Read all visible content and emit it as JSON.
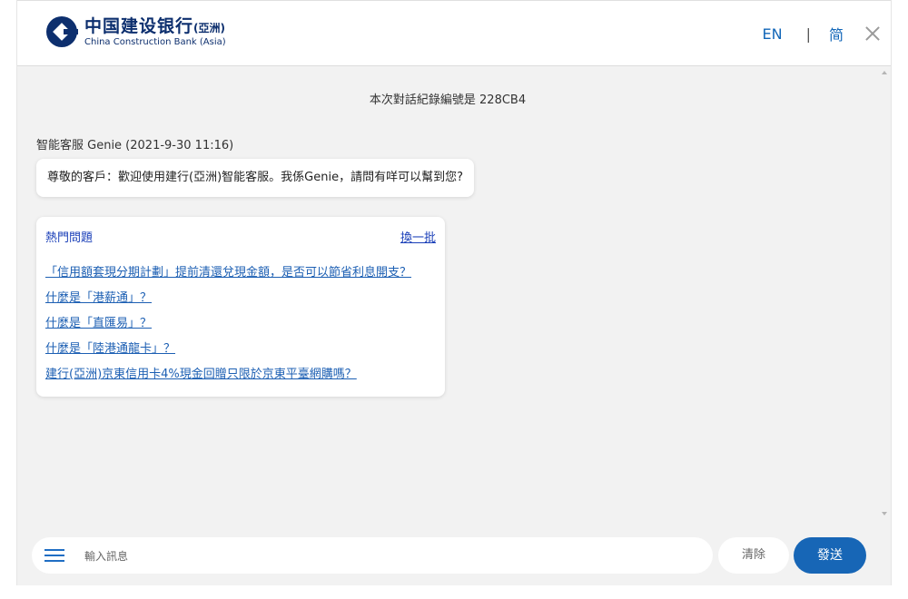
{
  "header": {
    "logo_cn": "中国建设银行",
    "logo_cn_suffix": "(亞洲)",
    "logo_en": "China Construction Bank (Asia)",
    "lang_en": "EN",
    "separator": "|",
    "lang_simplified": "简"
  },
  "chat": {
    "record_notice": "本次對話紀錄編號是 228CB4",
    "sender_line": "智能客服 Genie (2021-9-30 11:16)",
    "greeting": "尊敬的客戶：歡迎使用建行(亞洲)智能客服。我係Genie，請問有咩可以幫到您?",
    "hot_questions": {
      "title": "熱門問題",
      "refresh_label": "換一批",
      "items": [
        "「信用額套現分期計劃」提前清還兌現金額，是否可以節省利息開支？",
        "什麼是「港薪通」？",
        "什麼是「直匯易」？",
        "什麼是「陸港通龍卡」？",
        "建行(亞洲)京東信用卡4%現金回贈只限於京東平臺網購嗎？"
      ]
    }
  },
  "composer": {
    "placeholder": "輸入訊息",
    "clear_label": "清除",
    "send_label": "發送"
  },
  "colors": {
    "brand": "#0d2f6e",
    "accent": "#1766b6",
    "link": "#1c5fb3",
    "background": "#f2f2f2"
  },
  "icons": {
    "logo": "ccb-logo-icon",
    "close": "close-icon",
    "menu": "menu-icon"
  }
}
